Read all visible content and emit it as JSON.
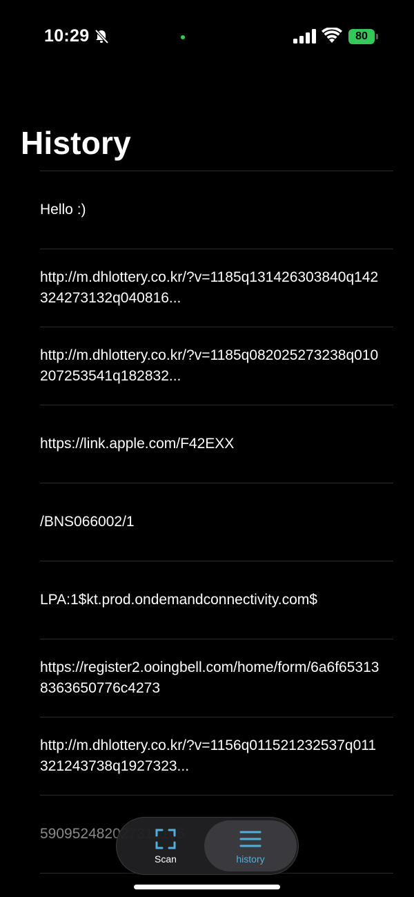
{
  "status_bar": {
    "time": "10:29",
    "battery": "80",
    "icons": [
      "bell-slash-icon",
      "signal-icon",
      "wifi-icon",
      "battery-icon"
    ],
    "battery_color": "#34c759",
    "indicator_color": "#2ccf4f"
  },
  "page": {
    "title": "History"
  },
  "history": {
    "items": [
      "Hello :)",
      "http://m.dhlottery.co.kr/?v=1185q131426303840q142324273132q040816...",
      "http://m.dhlottery.co.kr/?v=1185q082025273238q010207253541q182832...",
      "https://link.apple.com/F42EXX",
      "/BNS066002/1",
      "LPA:1$kt.prod.ondemandconnectivity.com$",
      "https://register2.ooingbell.com/home/form/6a6f653138363650776c4273",
      "http://m.dhlottery.co.kr/?v=1156q011521232537q011321243738q1927323...",
      "590952482027312165"
    ]
  },
  "tab_bar": {
    "scan_label": "Scan",
    "history_label": "history",
    "accent_color": "#4fb0dc"
  }
}
